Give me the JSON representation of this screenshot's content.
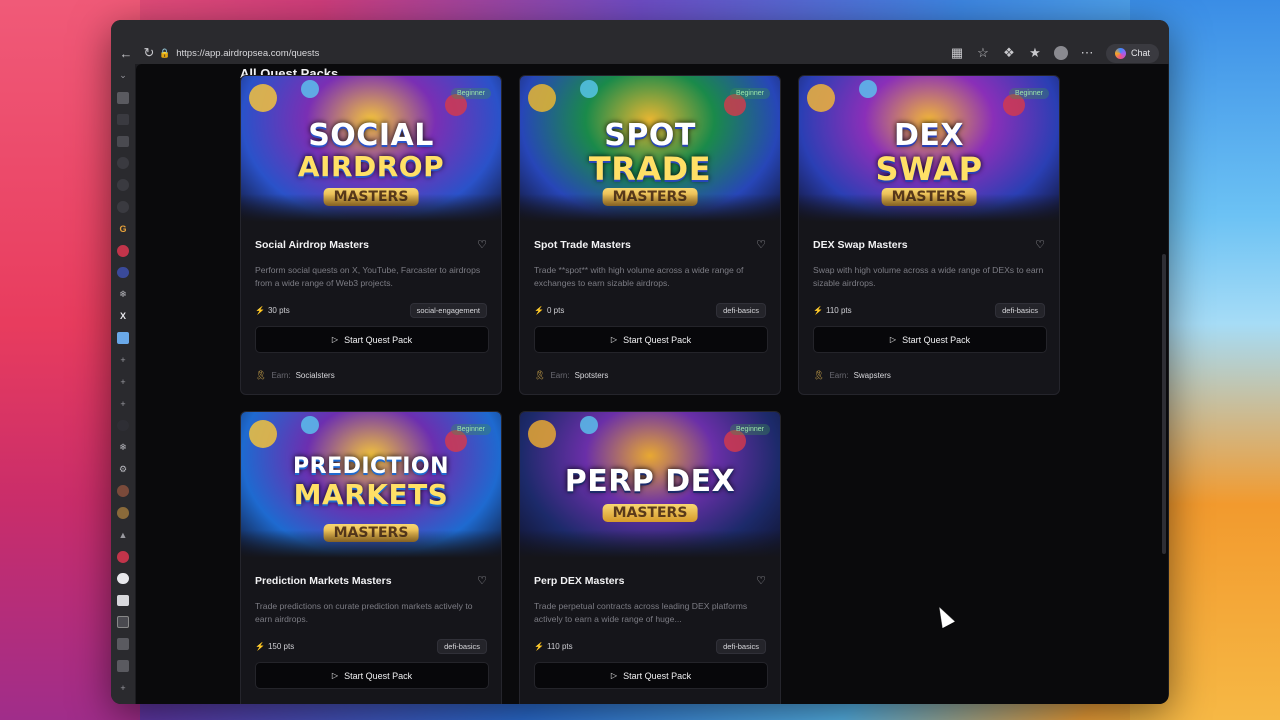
{
  "browser": {
    "url": "https://app.airdropsea.com/quests",
    "chat_label": "Chat"
  },
  "page": {
    "section_title": "All Quest Packs"
  },
  "cards": [
    {
      "title": "Social Airdrop Masters",
      "badge": "Beginner",
      "art_line1": "SOCIAL",
      "art_line2": "AIRDROP",
      "art_sub": "MASTERS",
      "description": "Perform social quests on X, YouTube, Farcaster to airdrops from a wide range of Web3 projects.",
      "points": "30 pts",
      "tag": "social-engagement",
      "button": "Start Quest Pack",
      "earn_label": "Earn:",
      "earn_value": "Socialsters",
      "colors": [
        "#2a52c9",
        "#7a2fb4",
        "#f3c23d"
      ]
    },
    {
      "title": "Spot Trade Masters",
      "badge": "Beginner",
      "art_line1": "SPOT",
      "art_line2": "TRADE",
      "art_sub": "MASTERS",
      "description": "Trade **spot** with high volume across a wide range of exchanges to earn sizable airdrops.",
      "points": "0 pts",
      "tag": "defi-basics",
      "button": "Start Quest Pack",
      "earn_label": "Earn:",
      "earn_value": "Spotsters",
      "colors": [
        "#2746b8",
        "#1a8a4a",
        "#e8b632"
      ]
    },
    {
      "title": "DEX Swap Masters",
      "badge": "Beginner",
      "art_line1": "DEX",
      "art_line2": "SWAP",
      "art_sub": "MASTERS",
      "description": "Swap with high volume across a wide range of DEXs to earn sizable airdrops.",
      "points": "110 pts",
      "tag": "defi-basics",
      "button": "Start Quest Pack",
      "earn_label": "Earn:",
      "earn_value": "Swapsters",
      "colors": [
        "#2a3fb4",
        "#8a2fb8",
        "#f0b43a"
      ]
    },
    {
      "title": "Prediction Markets Masters",
      "badge": "Beginner",
      "art_line1": "PREDICTION",
      "art_line2": "MARKETS",
      "art_sub": "MASTERS",
      "description": "Trade predictions on curate prediction markets actively to earn airdrops.",
      "points": "150 pts",
      "tag": "defi-basics",
      "button": "Start Quest Pack",
      "colors": [
        "#1e6ad0",
        "#6c2fb0",
        "#f2c23c"
      ]
    },
    {
      "title": "Perp DEX Masters",
      "badge": "Beginner",
      "art_line1": "PERP DEX",
      "art_line2": "",
      "art_sub": "MASTERS",
      "description": "Trade perpetual contracts across leading DEX platforms actively to earn a wide range of huge...",
      "points": "110 pts",
      "tag": "defi-basics",
      "button": "Start Quest Pack",
      "colors": [
        "#1c2a6a",
        "#6a2fa8",
        "#e8a832"
      ]
    }
  ]
}
